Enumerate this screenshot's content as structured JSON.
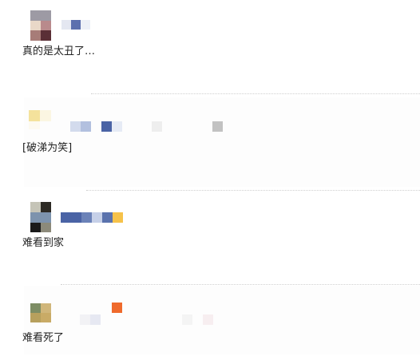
{
  "comments": [
    {
      "text": "真的是太丑了…"
    },
    {
      "text": "[破涕为笑]"
    },
    {
      "text": "难看到家"
    },
    {
      "text": "难看死了"
    }
  ],
  "colors": {
    "text": "#222222",
    "divider": "#cfcfcf",
    "accent_blue": "#4a63a5",
    "accent_light_blue": "#aebfe0",
    "accent_yellow": "#f6c24a",
    "accent_orange": "#ef6a2c"
  }
}
